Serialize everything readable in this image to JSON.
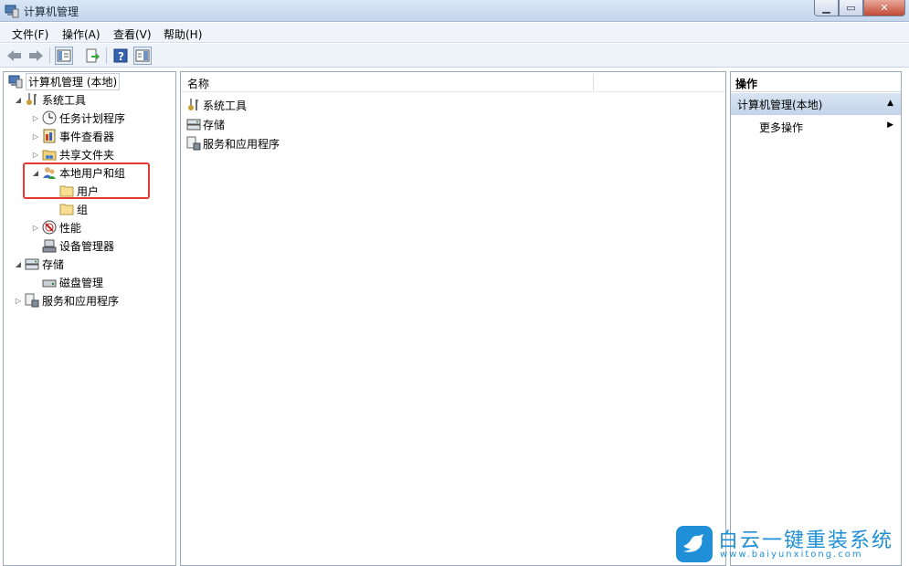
{
  "window": {
    "title": "计算机管理",
    "buttons": [
      "minimize",
      "maximize",
      "close"
    ]
  },
  "menu": [
    {
      "label": "文件(F)"
    },
    {
      "label": "操作(A)"
    },
    {
      "label": "查看(V)"
    },
    {
      "label": "帮助(H)"
    }
  ],
  "toolbar": {
    "icons": [
      "back-arrow-icon",
      "forward-arrow-icon",
      "show-tree-icon",
      "export-icon",
      "help-icon",
      "show-action-pane-icon"
    ]
  },
  "tree": [
    {
      "label": "计算机管理 (本地)",
      "icon": "computer-management-icon",
      "expander": ""
    },
    {
      "label": "系统工具",
      "icon": "tools-icon",
      "expander": "◢"
    },
    {
      "label": "任务计划程序",
      "icon": "clock-icon",
      "expander": "▷"
    },
    {
      "label": "事件查看器",
      "icon": "event-viewer-icon",
      "expander": "▷"
    },
    {
      "label": "共享文件夹",
      "icon": "shared-folder-icon",
      "expander": "▷"
    },
    {
      "label": "本地用户和组",
      "icon": "users-icon",
      "expander": "◢"
    },
    {
      "label": "用户",
      "icon": "folder-icon",
      "expander": ""
    },
    {
      "label": "组",
      "icon": "folder-icon",
      "expander": ""
    },
    {
      "label": "性能",
      "icon": "performance-icon",
      "expander": "▷"
    },
    {
      "label": "设备管理器",
      "icon": "device-manager-icon",
      "expander": ""
    },
    {
      "label": "存储",
      "icon": "storage-icon",
      "expander": "◢"
    },
    {
      "label": "磁盘管理",
      "icon": "disk-icon",
      "expander": ""
    },
    {
      "label": "服务和应用程序",
      "icon": "services-icon",
      "expander": "▷"
    }
  ],
  "middle": {
    "column_header": "名称",
    "items": [
      {
        "label": "系统工具",
        "icon": "tools-icon"
      },
      {
        "label": "存储",
        "icon": "storage-icon"
      },
      {
        "label": "服务和应用程序",
        "icon": "services-icon"
      }
    ]
  },
  "actions": {
    "header": "操作",
    "selected": "计算机管理(本地)",
    "item": "更多操作"
  },
  "watermark": {
    "title": "白云一键重装系统",
    "url": "www.baiyunxitong.com"
  },
  "colors": {
    "highlight": "#e23a33",
    "accent": "#1f8fd8"
  }
}
